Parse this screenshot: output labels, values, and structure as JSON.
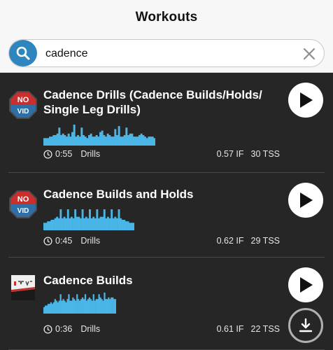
{
  "header": {
    "title": "Workouts"
  },
  "search": {
    "query": "cadence",
    "icon": "search-icon",
    "clear_icon": "close-icon"
  },
  "colors": {
    "accent": "#2f86bf",
    "profile": "#4ab5e7",
    "background": "#262626",
    "no_vid_red": "#c8302f",
    "no_vid_blue": "#2f6fa8"
  },
  "workouts": [
    {
      "title_lines": [
        "Cadence Drills (Cadence Builds/Holds/",
        "Single Leg Drills)"
      ],
      "badge": {
        "type": "no-vid",
        "line1": "NO",
        "line2": "VID"
      },
      "duration": "0:55",
      "category": "Drills",
      "if": "0.57 IF",
      "tss": "30 TSS",
      "profile": [
        5,
        5,
        5,
        6,
        6,
        7,
        7,
        8,
        12,
        7,
        8,
        7,
        6,
        8,
        6,
        9,
        14,
        6,
        7,
        6,
        12,
        7,
        6,
        5,
        7,
        8,
        6,
        6,
        7,
        6,
        9,
        10,
        7,
        6,
        8,
        7,
        6,
        6,
        11,
        7,
        13,
        6,
        6,
        7,
        12,
        7,
        8,
        8,
        6,
        6,
        6,
        7,
        8,
        7,
        6,
        5,
        6,
        6,
        6,
        5
      ],
      "actions": [
        "play"
      ]
    },
    {
      "title_lines": [
        "Cadence Builds and Holds"
      ],
      "badge": {
        "type": "no-vid",
        "line1": "NO",
        "line2": "VID"
      },
      "duration": "0:45",
      "category": "Drills",
      "if": "0.62 IF",
      "tss": "29 TSS",
      "profile": [
        5,
        5,
        6,
        6,
        7,
        7,
        8,
        9,
        8,
        14,
        8,
        9,
        8,
        14,
        8,
        9,
        8,
        14,
        9,
        9,
        8,
        14,
        8,
        9,
        8,
        14,
        8,
        9,
        8,
        14,
        8,
        9,
        9,
        14,
        8,
        9,
        8,
        14,
        8,
        9,
        8,
        14,
        8,
        7,
        7,
        6,
        6,
        5,
        5,
        5
      ],
      "actions": [
        "play"
      ]
    },
    {
      "title_lines": [
        "Cadence Builds"
      ],
      "badge": {
        "type": "thumbnail"
      },
      "duration": "0:36",
      "category": "Drills",
      "if": "0.61 IF",
      "tss": "22 TSS",
      "profile": [
        4,
        5,
        5,
        6,
        6,
        7,
        6,
        7,
        9,
        8,
        7,
        8,
        12,
        8,
        9,
        8,
        7,
        9,
        12,
        8,
        8,
        10,
        9,
        8,
        12,
        9,
        8,
        9,
        10,
        9,
        12,
        8,
        9,
        10,
        9,
        8,
        12,
        8,
        9,
        9,
        12,
        10,
        9,
        8,
        13,
        9,
        9,
        10,
        9,
        10,
        10,
        9,
        9
      ],
      "actions": [
        "play",
        "download"
      ]
    }
  ]
}
